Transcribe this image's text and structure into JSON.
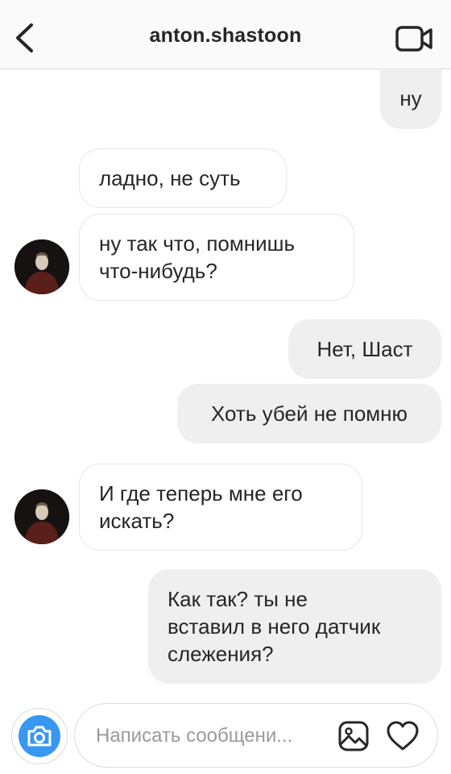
{
  "header": {
    "title": "anton.shastoon",
    "back_icon": "chevron-left-icon",
    "video_icon": "video-camera-icon"
  },
  "messages": [
    {
      "side": "out",
      "text": "ну"
    },
    {
      "side": "in",
      "text": "ладно, не суть"
    },
    {
      "side": "in",
      "text": "ну так что, помнишь\nчто-нибудь?"
    },
    {
      "side": "out",
      "text": "Нет, Шаст"
    },
    {
      "side": "out",
      "text": "Хоть убей не помню"
    },
    {
      "side": "in",
      "text": "И где теперь мне его\nискать?"
    },
    {
      "side": "out",
      "text": "Как так? ты не\nвставил в него датчик\nслежения?"
    }
  ],
  "composer": {
    "placeholder": "Написать сообщени...",
    "camera_icon": "camera-icon",
    "gallery_icon": "gallery-icon",
    "heart_icon": "heart-icon"
  },
  "colors": {
    "accent": "#3897f0",
    "outgoing_bubble": "#efefef",
    "incoming_border": "#e6e6e6"
  }
}
